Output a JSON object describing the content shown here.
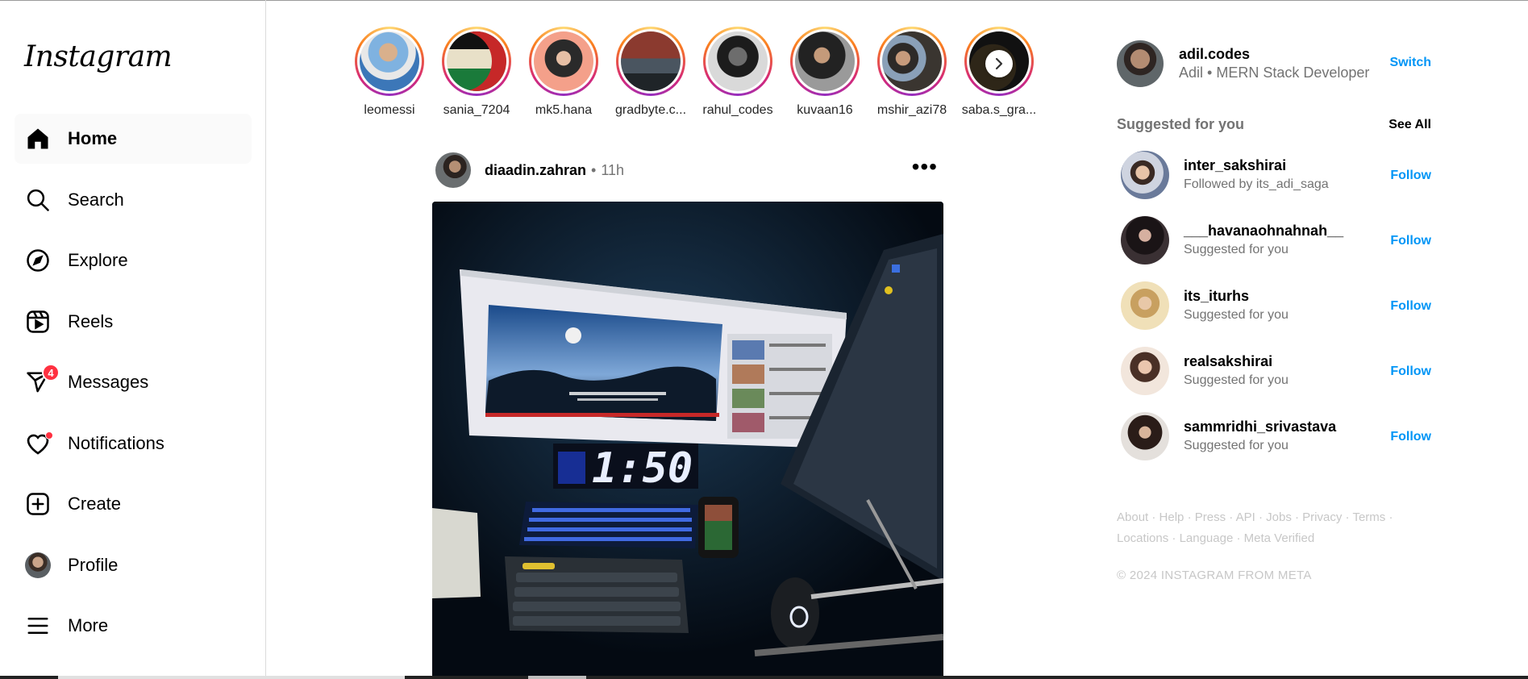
{
  "sidebar": {
    "logo": "Instagram",
    "nav": [
      {
        "label": "Home",
        "icon": "home-icon"
      },
      {
        "label": "Search",
        "icon": "search-icon"
      },
      {
        "label": "Explore",
        "icon": "compass-icon"
      },
      {
        "label": "Reels",
        "icon": "reels-icon"
      },
      {
        "label": "Messages",
        "icon": "messenger-icon",
        "badge": "4"
      },
      {
        "label": "Notifications",
        "icon": "heart-icon"
      },
      {
        "label": "Create",
        "icon": "plus-square-icon"
      },
      {
        "label": "Profile",
        "icon": "avatar"
      },
      {
        "label": "More",
        "icon": "hamburger-icon"
      }
    ]
  },
  "stories": [
    {
      "name": "leomessi"
    },
    {
      "name": "sania_7204"
    },
    {
      "name": "mk5.hana"
    },
    {
      "name": "gradbyte.c..."
    },
    {
      "name": "rahul_codes"
    },
    {
      "name": "kuvaan16"
    },
    {
      "name": "mshir_azi78"
    },
    {
      "name": "saba.s_gra..."
    }
  ],
  "post": {
    "username": "diaadin.zahran",
    "separator": "•",
    "time": "11h",
    "more": "•••",
    "clock_text": "1:50"
  },
  "account": {
    "username": "adil.codes",
    "subtitle": "Adil • MERN Stack Developer",
    "switch_label": "Switch"
  },
  "suggestions": {
    "title": "Suggested for you",
    "see_all": "See All",
    "items": [
      {
        "username": "inter_sakshirai",
        "subtitle": "Followed by its_adi_saga",
        "action": "Follow"
      },
      {
        "username": "___havanaohnahnah__",
        "subtitle": "Suggested for you",
        "action": "Follow"
      },
      {
        "username": "its_iturhs",
        "subtitle": "Suggested for you",
        "action": "Follow"
      },
      {
        "username": "realsakshirai",
        "subtitle": "Suggested for you",
        "action": "Follow"
      },
      {
        "username": "sammridhi_srivastava",
        "subtitle": "Suggested for you",
        "action": "Follow"
      }
    ]
  },
  "footer": {
    "links": [
      "About",
      "Help",
      "Press",
      "API",
      "Jobs",
      "Privacy",
      "Terms",
      "Locations",
      "Language",
      "Meta Verified"
    ],
    "separator": "·",
    "copyright": "© 2024 INSTAGRAM FROM META"
  },
  "colors": {
    "accent": "#0095f6",
    "badge": "#ff3040",
    "muted": "#737373"
  }
}
